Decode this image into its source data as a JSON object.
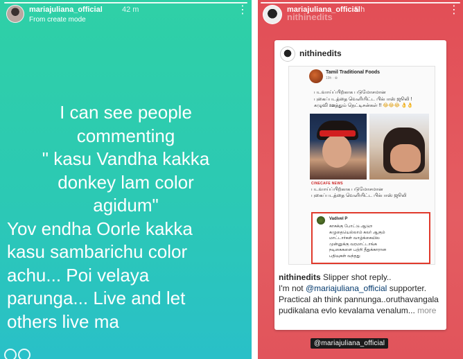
{
  "left_story": {
    "username": "mariajuliana_official",
    "time": "42 m",
    "subtitle": "From create mode",
    "body_lines": [
      "I can see people",
      "commenting",
      "\" kasu Vandha kakka",
      "donkey lam color",
      "agidum\"",
      "Yov endha Oorle kakka",
      "kasu sambarichu color",
      "achu...  Poi velaya",
      "parunga... Live and let",
      "others live ma"
    ],
    "background_colors": [
      "#2fd0a6",
      "#29c0c8"
    ]
  },
  "right_story": {
    "username": "mariajuliana_official",
    "username_overlay": "nithinedits",
    "time": "5 h",
    "background_color": "#e24e56",
    "post": {
      "account": "nithinedits",
      "shared": {
        "page_name": "Tamil Traditional Foods",
        "page_meta": "19h · ⊕",
        "caption_lines": [
          "படவாய்ப்பிற்காக படுமோசமான",
          "புகைப்படத்தை வெளியிட்ட பிக்பாஸ் ஜூலி !",
          "கழுவி ஊத்தும் நெட்டிசன்கள் !!"
        ],
        "caption_emojis": "😂😂😂 👌👌",
        "news_source": "CINECAFE NEWS",
        "news_caption_lines": [
          "படவாய்ப்பிற்காக படுமோசமான",
          "புகைப்படத்தை வெளியிட்ட பிக்பாஸ் ஜூலி"
        ],
        "comment": {
          "name": "Vadivel P",
          "lines": [
            "காசுக்கு போட்டு ஆடுற",
            "கழுதையெல்லாம் கலர் ஆகும்",
            "மாட்டார்கள் வாழ்க்கையில",
            "முன்னுக்கு வரமாட்டாங்க",
            "நடிகைகளை பற்றி தீதுக்காரான",
            "பதிவுகள் வந்தது"
          ]
        }
      },
      "caption": {
        "account": "nithinedits",
        "text1": "Slipper shot reply..",
        "text2_prefix": "I'm not",
        "mention": "@mariajuliana_official",
        "text2_suffix": "supporter.",
        "text3": "Practical ah think pannunga..oruthavangala",
        "text4": "pudikalana evlo kevalama venalum...",
        "more": "more"
      }
    },
    "mention_tag": "@mariajuliana_official"
  },
  "icons": [
    "avatar",
    "more-vertical-icon",
    "progress-bar"
  ]
}
